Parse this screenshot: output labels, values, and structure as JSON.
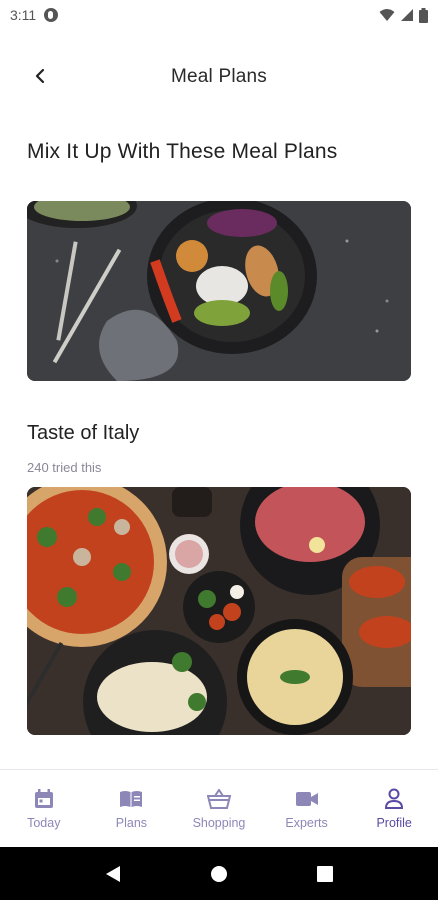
{
  "status_bar": {
    "time": "3:11"
  },
  "app_bar": {
    "title": "Meal Plans"
  },
  "content": {
    "section_heading": "Mix It Up With These Meal Plans",
    "plans": [
      {
        "title": "Taste of Italy",
        "tried_text": "240 tried this"
      }
    ]
  },
  "bottom_nav": {
    "items": [
      {
        "label": "Today",
        "icon": "calendar-icon"
      },
      {
        "label": "Plans",
        "icon": "book-icon"
      },
      {
        "label": "Shopping",
        "icon": "basket-icon"
      },
      {
        "label": "Experts",
        "icon": "video-icon"
      },
      {
        "label": "Profile",
        "icon": "person-icon"
      }
    ],
    "active_index": 4
  },
  "colors": {
    "nav_inactive": "#8d87b8",
    "nav_active": "#5a4aa3",
    "secondary_text": "#8a8899"
  }
}
